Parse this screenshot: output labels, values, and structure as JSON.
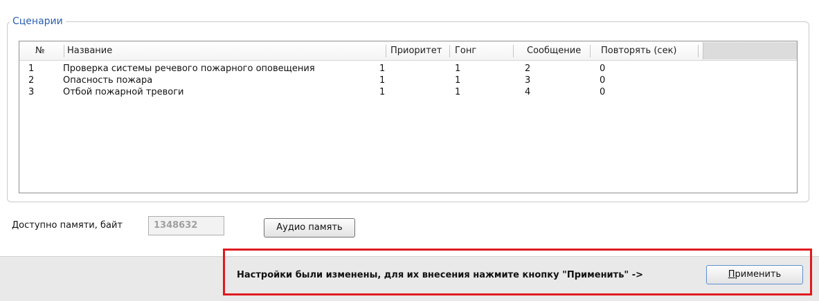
{
  "group": {
    "title": "Сценарии"
  },
  "table": {
    "columns": [
      "№",
      "Название",
      "Приоритет",
      "Гонг",
      "Сообщение",
      "Повторять (сек)"
    ],
    "rows": [
      [
        "1",
        "Проверка системы речевого пожарного оповещения",
        "1",
        "1",
        "2",
        "0"
      ],
      [
        "2",
        "Опасность пожара",
        "1",
        "1",
        "3",
        "0"
      ],
      [
        "3",
        "Отбой пожарной тревоги",
        "1",
        "1",
        "4",
        "0"
      ]
    ]
  },
  "memory": {
    "label": "Доступно памяти, байт",
    "value": "1348632",
    "audio_button": "Аудио память"
  },
  "notice": {
    "text": "Настройки были изменены, для их внесения нажмите кнопку \"Применить\" ->",
    "apply_button_first": "П",
    "apply_button_rest": "рименить"
  },
  "colors": {
    "group_title": "#2a5fb0",
    "notice_border": "#e0191e"
  }
}
